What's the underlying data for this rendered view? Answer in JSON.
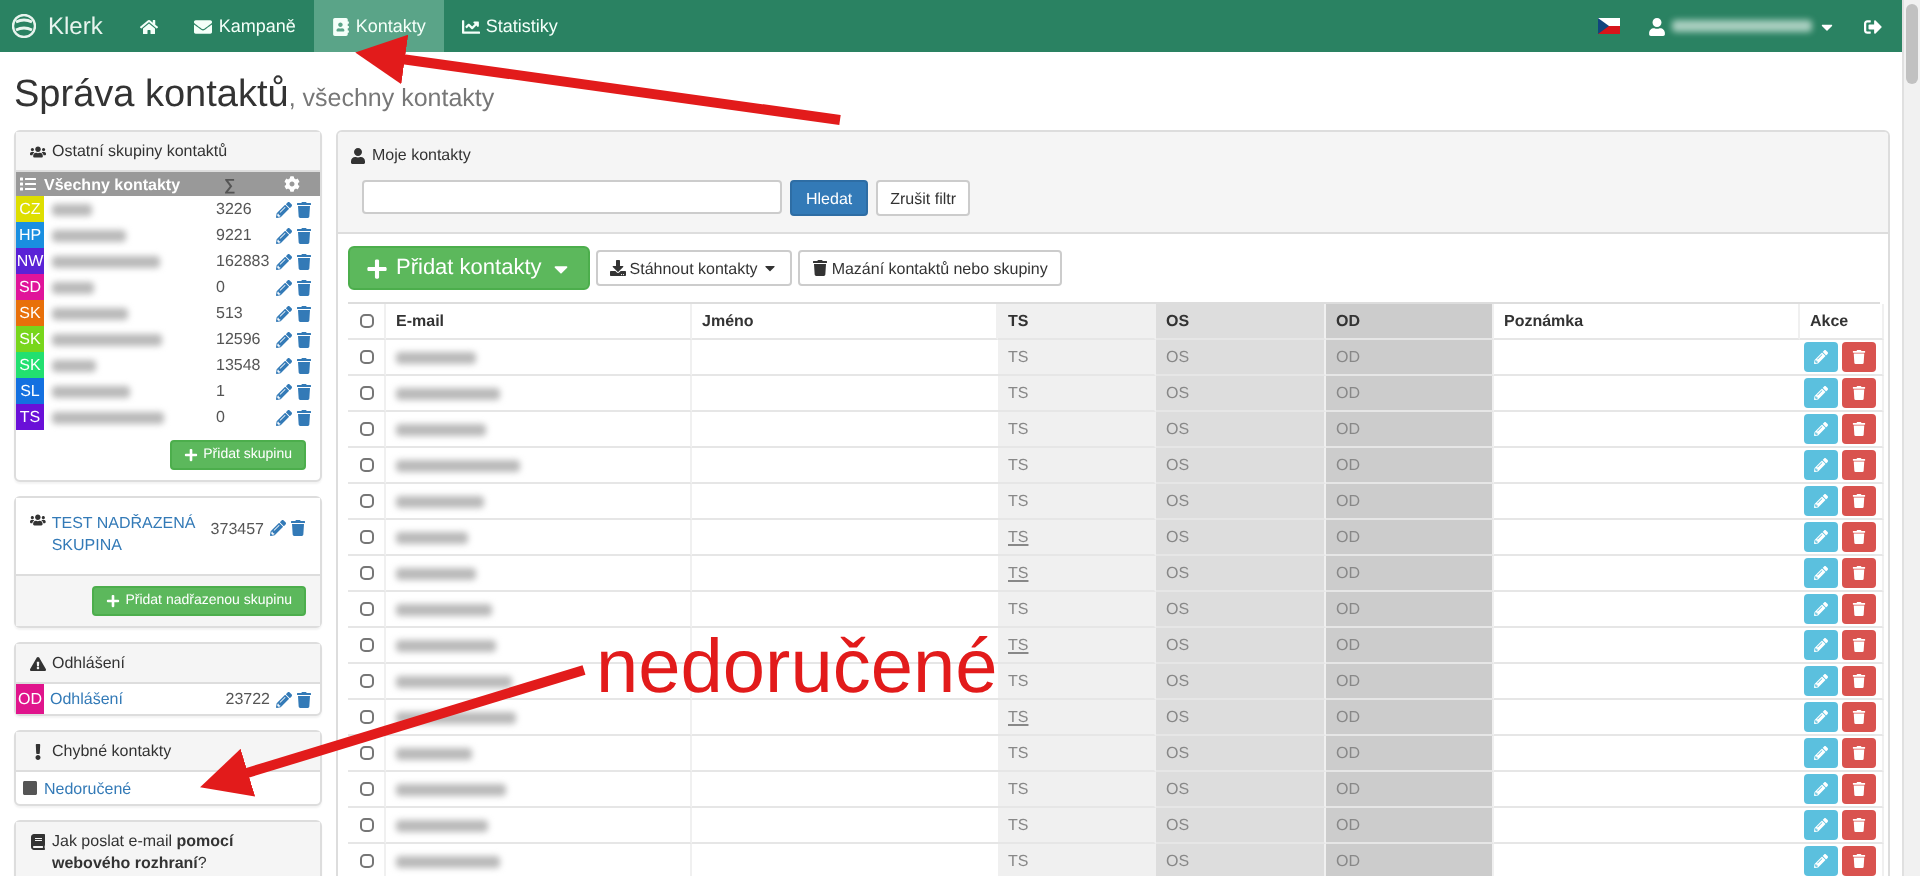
{
  "navbar": {
    "brand": "Klerk",
    "items": [
      {
        "kind": "home",
        "selected": false
      },
      {
        "kind": "mail",
        "label": "Kampaně",
        "selected": false
      },
      {
        "kind": "contacts",
        "label": "Kontakty",
        "selected": true
      },
      {
        "kind": "stats",
        "label": "Statistiky",
        "selected": false
      }
    ]
  },
  "page_title": {
    "main": "Správa kontaktů",
    "sub": ", všechny kontakty"
  },
  "groups_panel": {
    "title": "Ostatní skupiny kontaktů",
    "header": {
      "label": "Všechny kontakty",
      "sum": "∑"
    },
    "groups": [
      {
        "code": "CZ",
        "color": "#dede00",
        "count": "3226"
      },
      {
        "code": "HP",
        "color": "#1a8fe0",
        "count": "9221"
      },
      {
        "code": "NW",
        "color": "#5a22d6",
        "count": "162883"
      },
      {
        "code": "SD",
        "color": "#e0149a",
        "count": "0"
      },
      {
        "code": "SK",
        "color": "#e8700a",
        "count": "513"
      },
      {
        "code": "SK",
        "color": "#78d61c",
        "count": "12596"
      },
      {
        "code": "SK",
        "color": "#22e070",
        "count": "13548"
      },
      {
        "code": "SL",
        "color": "#1470e0",
        "count": "1"
      },
      {
        "code": "TS",
        "color": "#6a10d8",
        "count": "0"
      }
    ],
    "add_button": "Přidat skupinu"
  },
  "parent_panel": {
    "name": "TEST NADŘAZENÁ SKUPINA",
    "count": "373457",
    "add_button": "Přidat nadřazenou skupinu"
  },
  "unsubscribed_panel": {
    "title": "Odhlášení",
    "row": {
      "code": "OD",
      "color": "#e0148c",
      "name": "Odhlášení",
      "count": "23722"
    }
  },
  "errors_panel": {
    "title": "Chybné kontakty",
    "row": {
      "name": "Nedoručené"
    }
  },
  "help_panel": {
    "text": "Jak poslat e-mail **pomocí webového rozhraní**?"
  },
  "contacts": {
    "title": "Moje kontakty",
    "search": {
      "button": "Hledat",
      "reset": "Zrušit filtr"
    },
    "buttons": {
      "add": "Přidat kontakty",
      "download": "Stáhnout kontakty",
      "delete": "Mazání kontaktů nebo skupiny"
    },
    "select_all_checked": false,
    "columns": [
      "E-mail",
      "Jméno",
      "TS",
      "OS",
      "OD",
      "Poznámka",
      "Akce"
    ],
    "rows": [
      {
        "checked": false,
        "ts": "TS",
        "ts_link": false,
        "os": "OS",
        "od": "OD"
      },
      {
        "checked": false,
        "ts": "TS",
        "ts_link": false,
        "os": "OS",
        "od": "OD"
      },
      {
        "checked": false,
        "ts": "TS",
        "ts_link": false,
        "os": "OS",
        "od": "OD"
      },
      {
        "checked": false,
        "ts": "TS",
        "ts_link": false,
        "os": "OS",
        "od": "OD"
      },
      {
        "checked": false,
        "ts": "TS",
        "ts_link": false,
        "os": "OS",
        "od": "OD"
      },
      {
        "checked": false,
        "ts": "TS",
        "ts_link": true,
        "os": "OS",
        "od": "OD"
      },
      {
        "checked": false,
        "ts": "TS",
        "ts_link": true,
        "os": "OS",
        "od": "OD"
      },
      {
        "checked": false,
        "ts": "TS",
        "ts_link": false,
        "os": "OS",
        "od": "OD"
      },
      {
        "checked": false,
        "ts": "TS",
        "ts_link": true,
        "os": "OS",
        "od": "OD"
      },
      {
        "checked": false,
        "ts": "TS",
        "ts_link": false,
        "os": "OS",
        "od": "OD"
      },
      {
        "checked": false,
        "ts": "TS",
        "ts_link": true,
        "os": "OS",
        "od": "OD"
      },
      {
        "checked": false,
        "ts": "TS",
        "ts_link": false,
        "os": "OS",
        "od": "OD"
      },
      {
        "checked": false,
        "ts": "TS",
        "ts_link": false,
        "os": "OS",
        "od": "OD"
      },
      {
        "checked": false,
        "ts": "TS",
        "ts_link": false,
        "os": "OS",
        "od": "OD"
      },
      {
        "checked": false,
        "ts": "TS",
        "ts_link": false,
        "os": "OS",
        "od": "OD"
      }
    ]
  },
  "annotation": {
    "text": "nedoručené"
  }
}
